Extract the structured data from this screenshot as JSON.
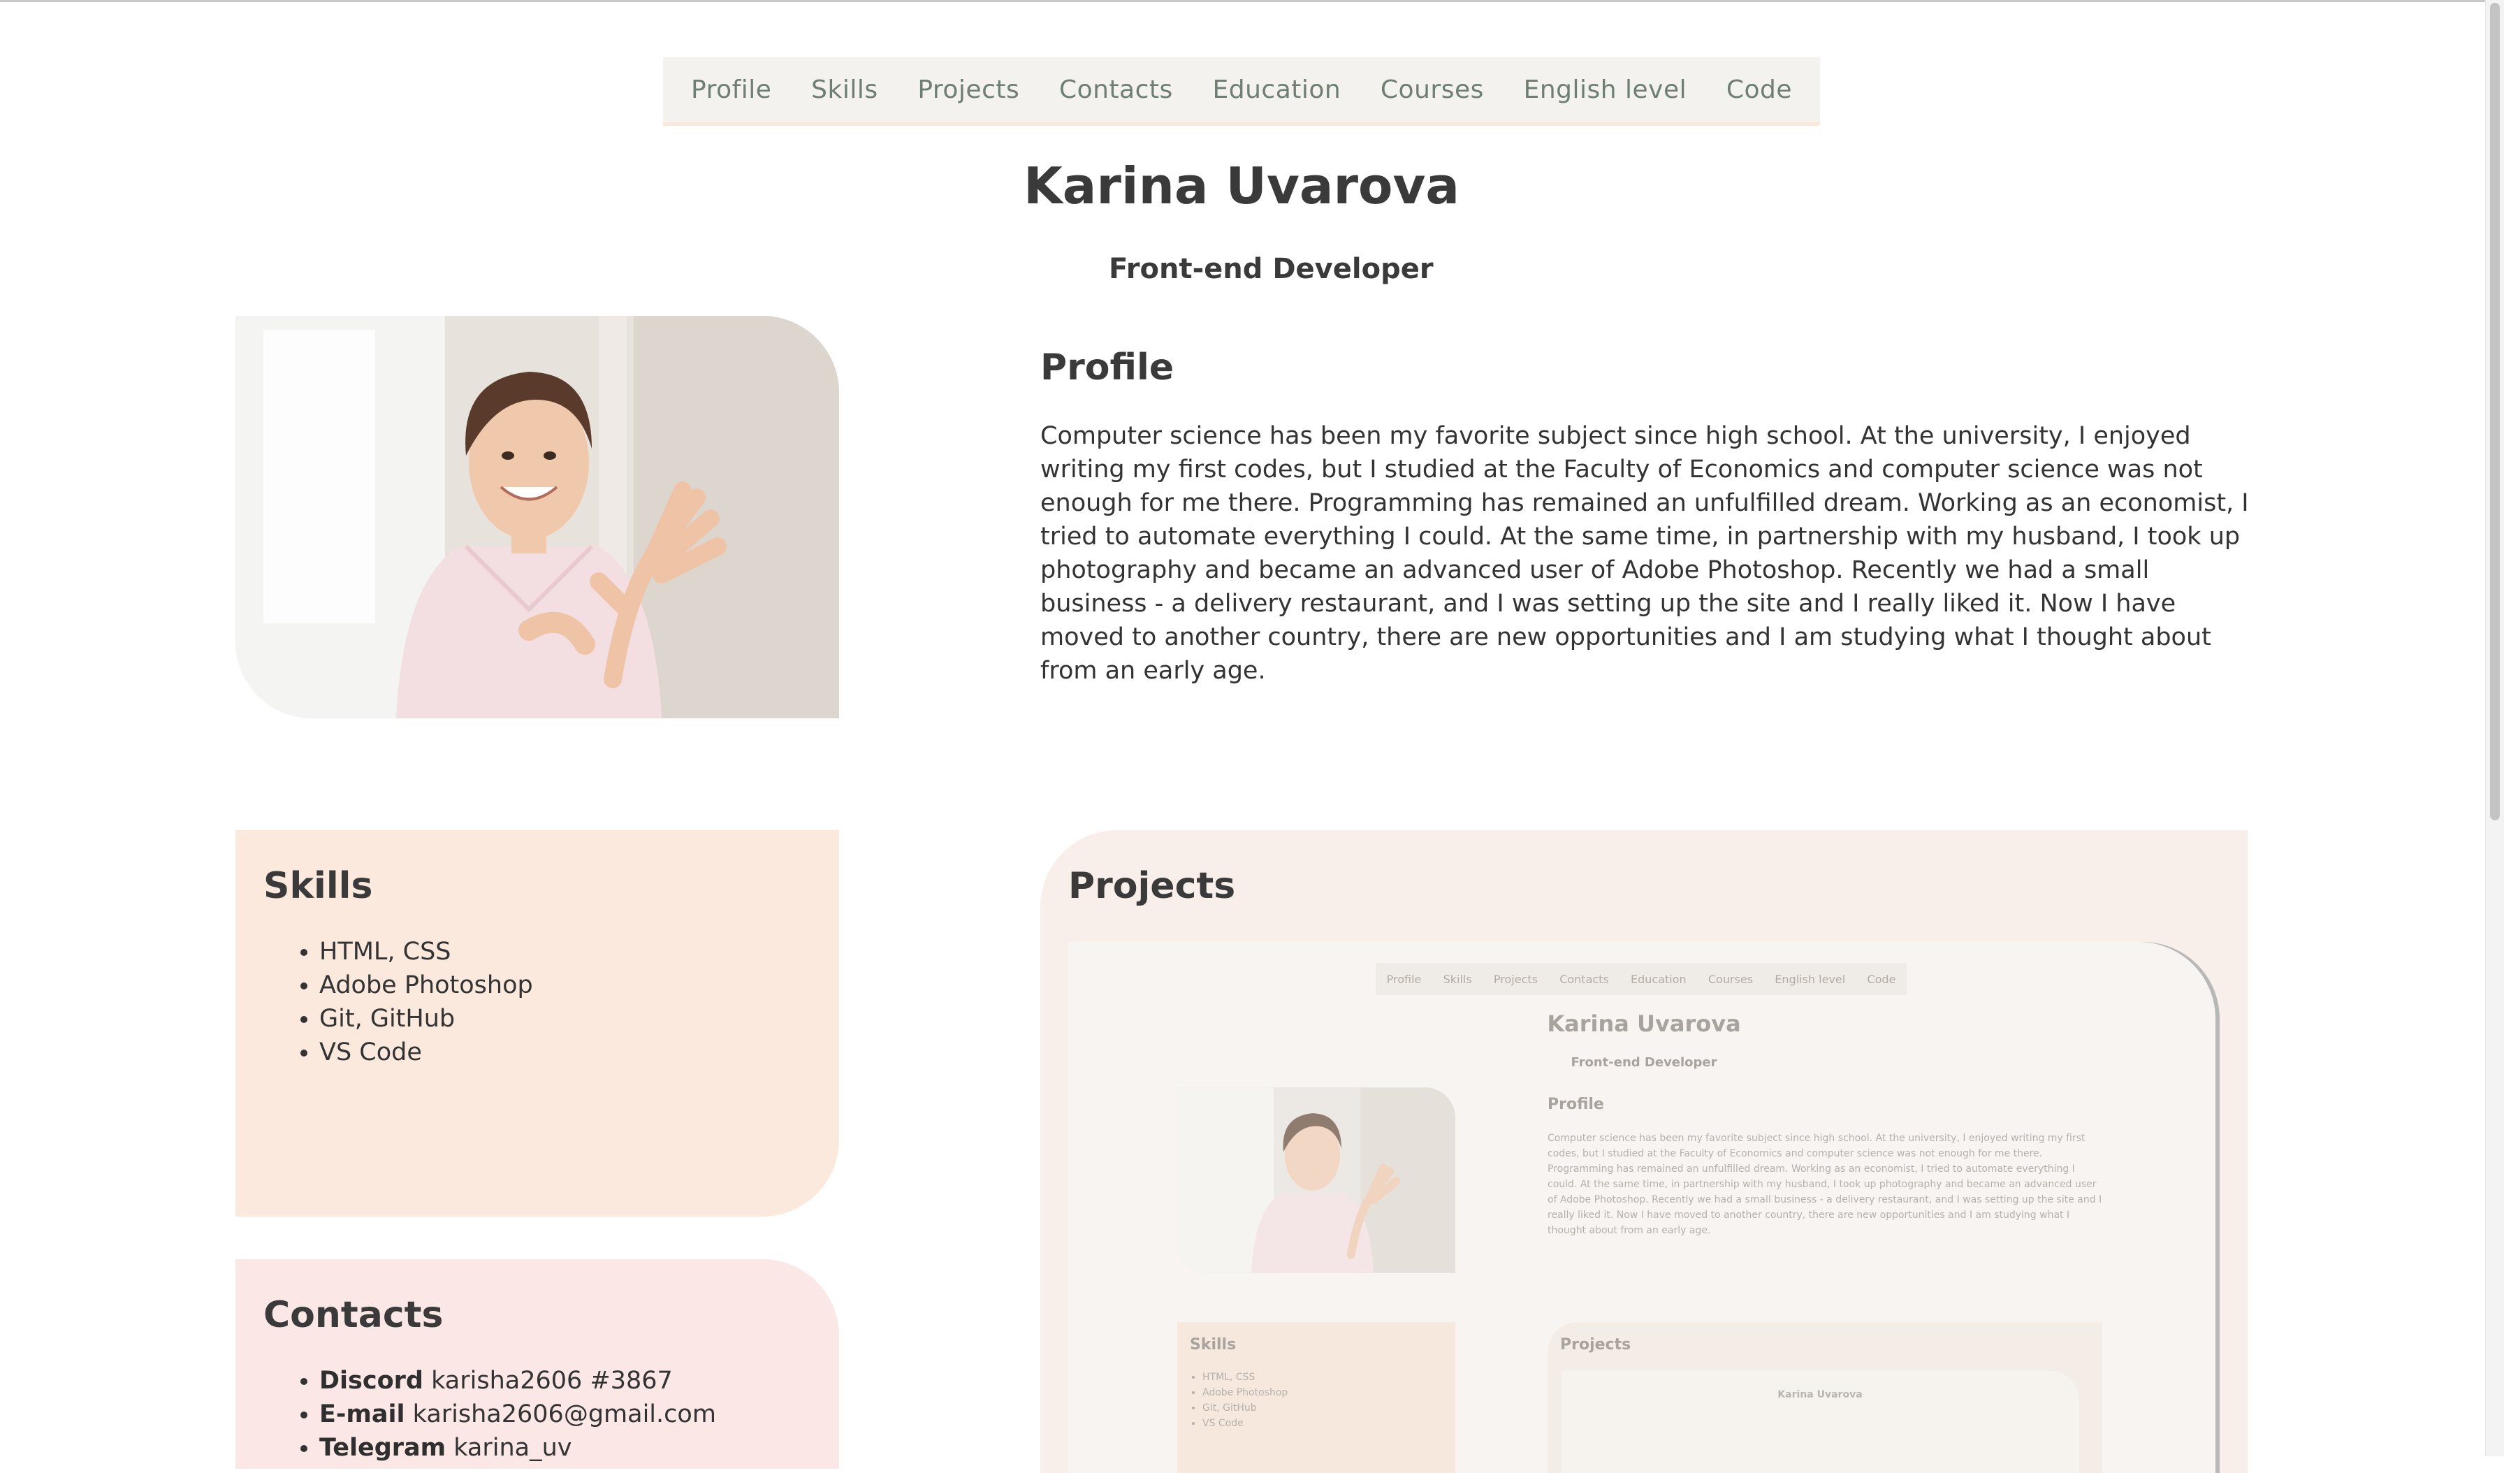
{
  "nav": {
    "items": [
      "Profile",
      "Skills",
      "Projects",
      "Contacts",
      "Education",
      "Courses",
      "English level",
      "Code"
    ]
  },
  "header": {
    "name": "Karina Uvarova",
    "role": "Front-end Developer"
  },
  "profile": {
    "title": "Profile",
    "text": "Computer science has been my favorite subject since high school. At the university, I enjoyed writing my first codes, but I studied at the Faculty of Economics and computer science was not enough for me there. Programming has remained an unfulfilled dream. Working as an economist, I tried to automate everything I could. At the same time, in partnership with my husband, I took up photography and became an advanced user of Adobe Photoshop. Recently we had a small business - a delivery restaurant, and I was setting up the site and I really liked it. Now I have moved to another country, there are new opportunities and I am studying what I thought about from an early age."
  },
  "skills": {
    "title": "Skills",
    "items": [
      "HTML, CSS",
      "Adobe Photoshop",
      "Git, GitHub",
      "VS Code"
    ]
  },
  "contacts": {
    "title": "Contacts",
    "items": [
      {
        "label": "Discord",
        "value": "karisha2606 #3867"
      },
      {
        "label": "E-mail",
        "value": "karisha2606@gmail.com"
      },
      {
        "label": "Telegram",
        "value": "karina_uv"
      }
    ]
  },
  "projects": {
    "title": "Projects"
  },
  "colors": {
    "accent_nav_text": "#6e7f72",
    "skills_bg": "#fbe9de",
    "contacts_bg": "#fbe7e6",
    "projects_bg": "#f9efea"
  }
}
